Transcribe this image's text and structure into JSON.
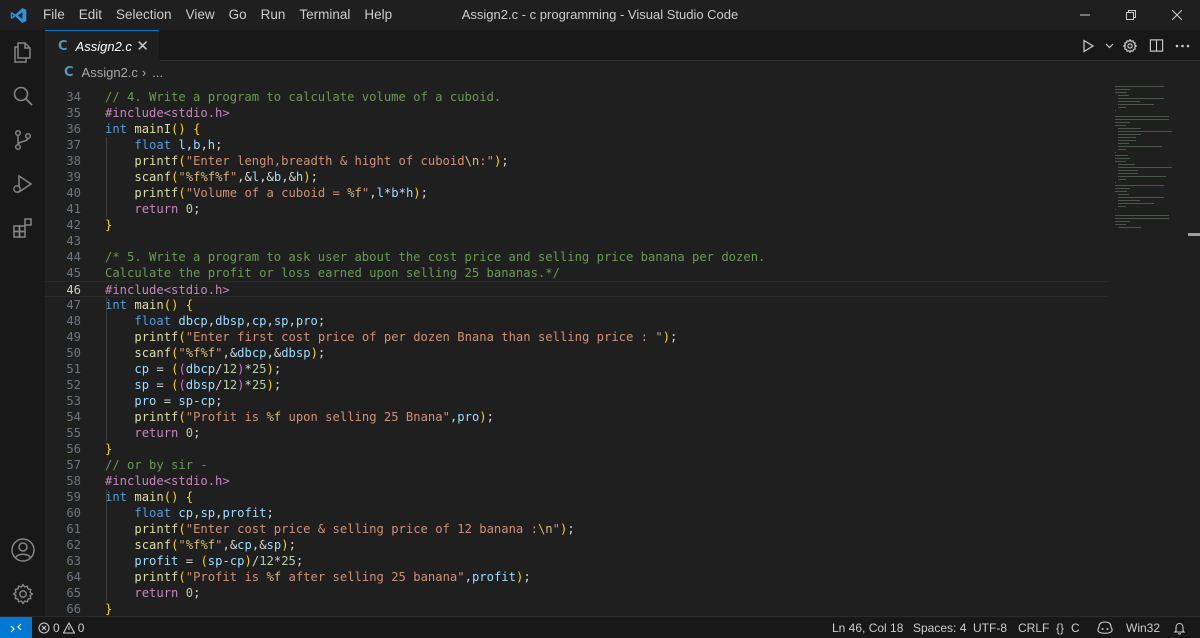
{
  "window": {
    "title": "Assign2.c - c programming - Visual Studio Code",
    "menu": [
      "File",
      "Edit",
      "Selection",
      "View",
      "Go",
      "Run",
      "Terminal",
      "Help"
    ]
  },
  "tab": {
    "icon_glyph": "C",
    "label": "Assign2.c",
    "close": "✕"
  },
  "breadcrumb": {
    "icon_glyph": "C",
    "file": "Assign2.c",
    "separator": "›",
    "ellipsis": "..."
  },
  "activity_icons": [
    "files-icon",
    "search-icon",
    "source-control-icon",
    "run-debug-icon",
    "extensions-icon",
    "account-icon",
    "settings-gear-icon"
  ],
  "editor": {
    "current_line": 46,
    "lines": [
      {
        "n": "34",
        "code": "// 4. Write a program to calculate volume of a cuboid."
      },
      {
        "n": "35",
        "code": "#include<stdio.h>"
      },
      {
        "n": "36",
        "code": "int mainI() {"
      },
      {
        "n": "37",
        "code": "    float l,b,h;"
      },
      {
        "n": "38",
        "code": "    printf(\"Enter lengh,breadth & hight of cuboid\\n:\");"
      },
      {
        "n": "39",
        "code": "    scanf(\"%f%f%f\",&l,&b,&h);"
      },
      {
        "n": "40",
        "code": "    printf(\"Volume of a cuboid = %f\",l*b*h);"
      },
      {
        "n": "41",
        "code": "    return 0;"
      },
      {
        "n": "42",
        "code": "}"
      },
      {
        "n": "43",
        "code": ""
      },
      {
        "n": "44",
        "code": "/* 5. Write a program to ask user about the cost price and selling price banana per dozen."
      },
      {
        "n": "45",
        "code": "Calculate the profit or loss earned upon selling 25 bananas.*/"
      },
      {
        "n": "46",
        "code": "#include<stdio.h>"
      },
      {
        "n": "47",
        "code": "int main() {"
      },
      {
        "n": "48",
        "code": "    float dbcp,dbsp,cp,sp,pro;"
      },
      {
        "n": "49",
        "code": "    printf(\"Enter first cost price of per dozen Bnana than selling price : \");"
      },
      {
        "n": "50",
        "code": "    scanf(\"%f%f\",&dbcp,&dbsp);"
      },
      {
        "n": "51",
        "code": "    cp = ((dbcp/12)*25);"
      },
      {
        "n": "52",
        "code": "    sp = ((dbsp/12)*25);"
      },
      {
        "n": "53",
        "code": "    pro = sp-cp;"
      },
      {
        "n": "54",
        "code": "    printf(\"Profit is %f upon selling 25 Bnana\",pro);"
      },
      {
        "n": "55",
        "code": "    return 0;"
      },
      {
        "n": "56",
        "code": "}"
      },
      {
        "n": "57",
        "code": "// or by sir -"
      },
      {
        "n": "58",
        "code": "#include<stdio.h>"
      },
      {
        "n": "59",
        "code": "int main() {"
      },
      {
        "n": "60",
        "code": "    float cp,sp,profit;"
      },
      {
        "n": "61",
        "code": "    printf(\"Enter cost price & selling price of 12 banana :\\n\");"
      },
      {
        "n": "62",
        "code": "    scanf(\"%f%f\",&cp,&sp);"
      },
      {
        "n": "63",
        "code": "    profit = (sp-cp)/12*25;"
      },
      {
        "n": "64",
        "code": "    printf(\"Profit is %f after selling 25 banana\",profit);"
      },
      {
        "n": "65",
        "code": "    return 0;"
      },
      {
        "n": "66",
        "code": "}"
      }
    ]
  },
  "statusbar": {
    "errors": "0",
    "warnings": "0",
    "position": "Ln 46, Col 18",
    "spaces": "Spaces: 4",
    "encoding": "UTF-8",
    "eol": "CRLF",
    "language_braces": "{}",
    "language": "C",
    "platform": "Win32"
  },
  "colors": {
    "accent": "#0078d4",
    "editor_bg": "#1f1f1f",
    "comment": "#6a9955",
    "keyword": "#569cd6",
    "string": "#ce9178",
    "function": "#dcdcaa",
    "variable": "#9cdcfe"
  }
}
